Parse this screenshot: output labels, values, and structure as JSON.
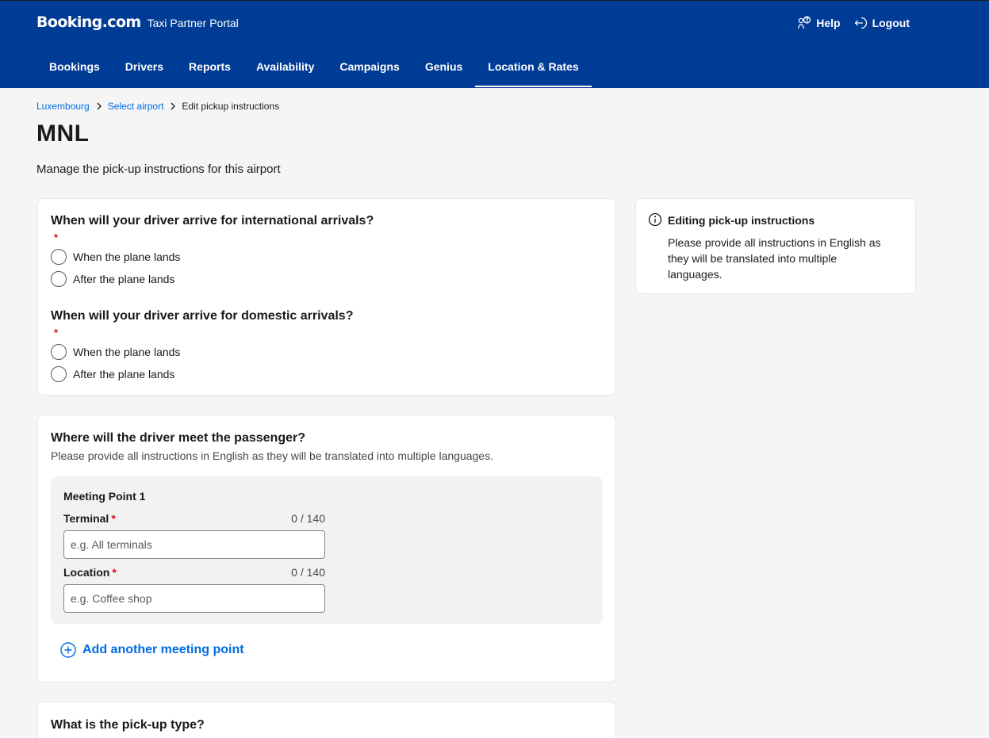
{
  "header": {
    "logo": "Booking.com",
    "portal": "Taxi Partner Portal",
    "help": "Help",
    "logout": "Logout"
  },
  "nav": [
    {
      "label": "Bookings"
    },
    {
      "label": "Drivers"
    },
    {
      "label": "Reports"
    },
    {
      "label": "Availability"
    },
    {
      "label": "Campaigns"
    },
    {
      "label": "Genius"
    },
    {
      "label": "Location & Rates"
    }
  ],
  "breadcrumb": {
    "items": [
      "Luxembourg",
      "Select airport"
    ],
    "current": "Edit pickup instructions"
  },
  "page": {
    "title": "MNL",
    "subtitle": "Manage the pick-up instructions for this airport"
  },
  "arrival_card": {
    "international": {
      "question": "When will your driver arrive for international arrivals?",
      "required_mark": "*",
      "options": [
        "When the plane lands",
        "After the plane lands"
      ]
    },
    "domestic": {
      "question": "When will your driver arrive for domestic arrivals?",
      "required_mark": "*",
      "options": [
        "When the plane lands",
        "After the plane lands"
      ]
    }
  },
  "meeting_card": {
    "question": "Where will the driver meet the passenger?",
    "hint": "Please provide all instructions in English as they will be translated into multiple languages.",
    "meeting_point": {
      "title": "Meeting Point 1",
      "terminal": {
        "label": "Terminal",
        "required_mark": "*",
        "counter": "0 / 140",
        "placeholder": "e.g. All terminals",
        "value": ""
      },
      "location": {
        "label": "Location",
        "required_mark": "*",
        "counter": "0 / 140",
        "placeholder": "e.g. Coffee shop",
        "value": ""
      }
    },
    "add_label": "Add another meeting point"
  },
  "pickup_card": {
    "question": "What is the pick-up type?"
  },
  "info_box": {
    "title": "Editing pick-up instructions",
    "body": "Please provide all instructions in English as they will be translated into multiple languages."
  },
  "colors": {
    "header_bg": "#003b95",
    "link": "#006ce4",
    "required": "#d4111e",
    "page_bg": "#f5f5f5"
  }
}
